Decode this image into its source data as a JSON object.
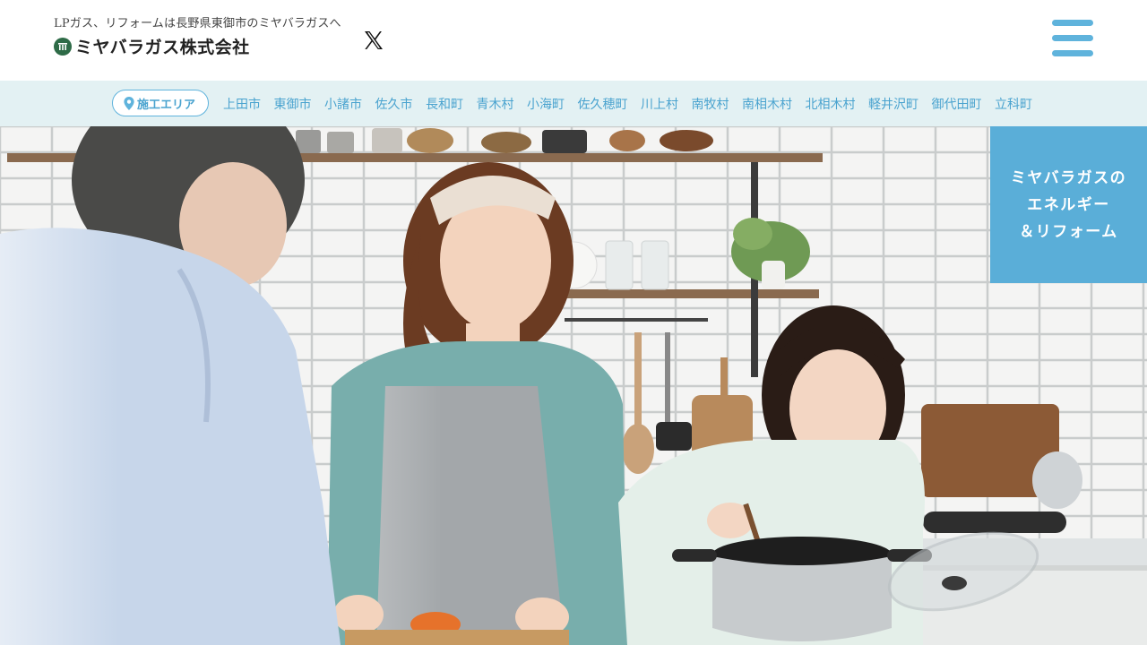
{
  "header": {
    "tagline": "LPガス、リフォームは長野県東御市のミヤバラガスへ",
    "logo_text": "ミヤバラガス株式会社",
    "social_icon": "x-icon",
    "menu_icon": "hamburger-icon"
  },
  "area_nav": {
    "badge_label": "施工エリア",
    "badge_icon": "map-pin-icon",
    "areas": [
      "上田市",
      "東御市",
      "小諸市",
      "佐久市",
      "長和町",
      "青木村",
      "小海町",
      "佐久穂町",
      "川上村",
      "南牧村",
      "南相木村",
      "北相木村",
      "軽井沢町",
      "御代田町",
      "立科町"
    ]
  },
  "hero": {
    "badge_lines": [
      "ミヤバラガスの",
      "エネルギー",
      "＆リフォーム"
    ]
  },
  "colors": {
    "accent": "#5fb3dc",
    "nav_bg": "#e3f1f3",
    "badge_bg": "#5aaed8",
    "logo_green": "#2e6b47"
  }
}
